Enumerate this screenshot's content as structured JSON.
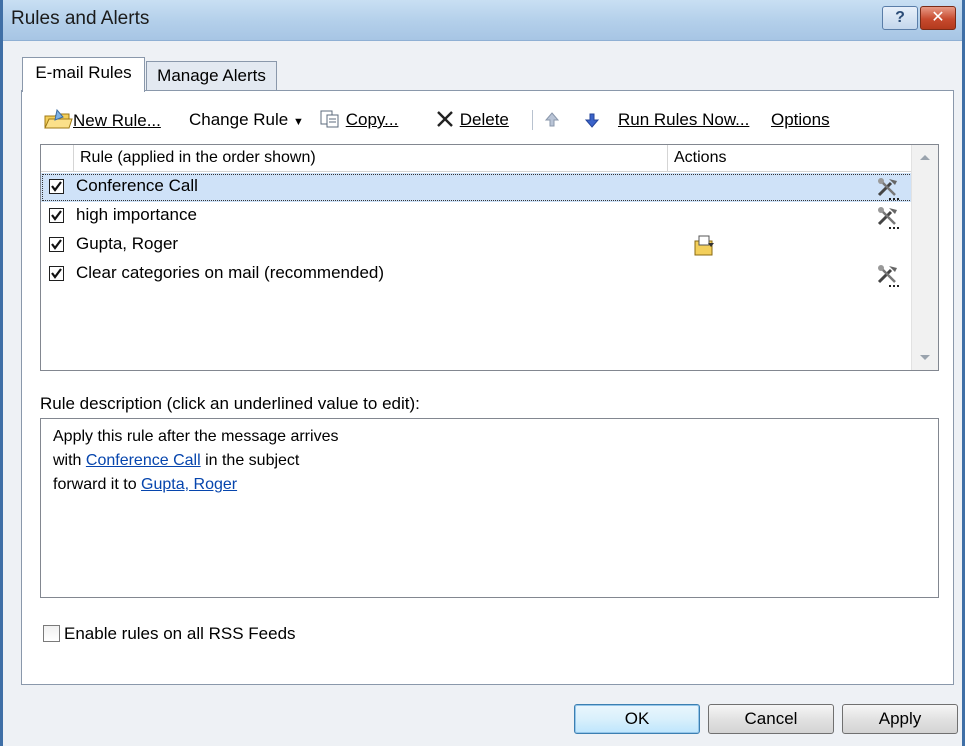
{
  "window": {
    "title": "Rules and Alerts",
    "help_label": "?",
    "close_label": "✕"
  },
  "tabs": [
    {
      "label": "E-mail Rules",
      "active": true
    },
    {
      "label": "Manage Alerts",
      "active": false
    }
  ],
  "toolbar": {
    "new_rule": "New Rule...",
    "change_rule": "Change Rule",
    "copy": "Copy...",
    "delete": "Delete",
    "run_rules_now": "Run Rules Now...",
    "options": "Options"
  },
  "rules_list": {
    "columns": [
      "Rule (applied in the order shown)",
      "Actions"
    ],
    "rows": [
      {
        "name": "Conference Call",
        "checked": true,
        "selected": true,
        "action_icon": "tools-icon"
      },
      {
        "name": "high importance",
        "checked": true,
        "selected": false,
        "action_icon": "tools-icon"
      },
      {
        "name": "Gupta, Roger",
        "checked": true,
        "selected": false,
        "action_icon": "move-to-folder-icon"
      },
      {
        "name": "Clear categories on mail (recommended)",
        "checked": true,
        "selected": false,
        "action_icon": "tools-icon"
      }
    ]
  },
  "description": {
    "label": "Rule description (click an underlined value to edit):",
    "line1": "Apply this rule after the message arrives",
    "line2_prefix": "with ",
    "line2_link": "Conference Call",
    "line2_suffix": " in the subject",
    "line3_prefix": "forward it to ",
    "line3_link": "Gupta, Roger"
  },
  "rss": {
    "label": "Enable rules on all RSS Feeds",
    "checked": false
  },
  "buttons": {
    "ok": "OK",
    "cancel": "Cancel",
    "apply": "Apply"
  }
}
